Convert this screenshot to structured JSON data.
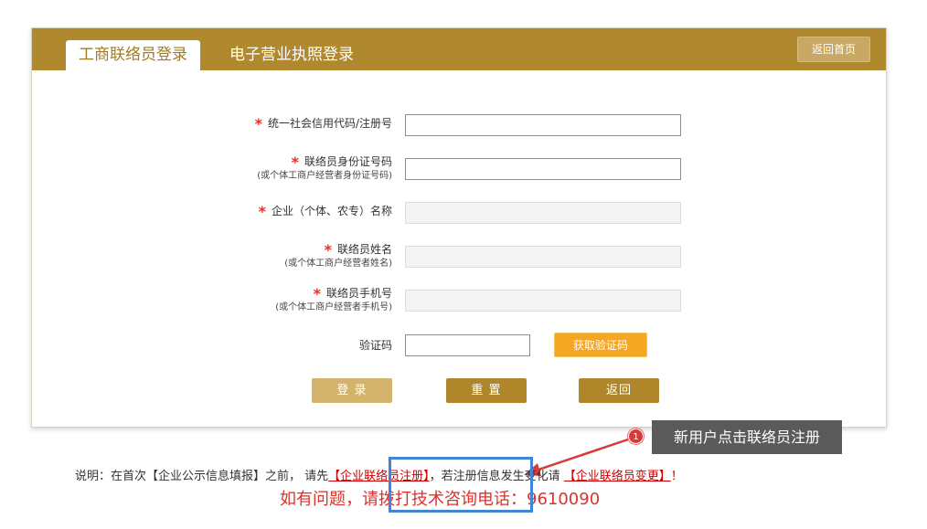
{
  "header": {
    "tabs": [
      {
        "label": "工商联络员登录",
        "active": true
      },
      {
        "label": "电子营业执照登录",
        "active": false
      }
    ],
    "home_label": "返回首页"
  },
  "form": {
    "required_mark": "*",
    "fields": [
      {
        "label": "统一社会信用代码/注册号",
        "sub": "",
        "required": true,
        "value": "",
        "disabled": false
      },
      {
        "label": "联络员身份证号码",
        "sub": "(或个体工商户经营者身份证号码)",
        "required": true,
        "value": "",
        "disabled": false
      },
      {
        "label": "企业（个体、农专）名称",
        "sub": "",
        "required": true,
        "value": "",
        "disabled": true
      },
      {
        "label": "联络员姓名",
        "sub": "(或个体工商户经营者姓名)",
        "required": true,
        "value": "",
        "disabled": true
      },
      {
        "label": "联络员手机号",
        "sub": "(或个体工商户经营者手机号)",
        "required": true,
        "value": "",
        "disabled": true
      }
    ],
    "captcha_label": "验证码",
    "captcha_value": "",
    "sms_button": "获取验证码"
  },
  "actions": {
    "login": "登 录",
    "reset": "重 置",
    "back": "返回"
  },
  "callout": {
    "badge": "1",
    "text": "新用户点击联络员注册"
  },
  "notes": {
    "prefix": "说明：在首次【企业公示信息填报】之前， 请先",
    "register_link": "【企业联络员注册】",
    "middle": "，若注册信息发生变化请 ",
    "change_link": "【企业联络员变更】",
    "suffix": "！",
    "hotline": "如有问题，请拨打技术咨询电话：9610090"
  },
  "colors": {
    "header_bg": "#b0892f",
    "accent_red": "#d9332e",
    "highlight_blue": "#3f86d8",
    "sms_orange": "#f5a623"
  }
}
